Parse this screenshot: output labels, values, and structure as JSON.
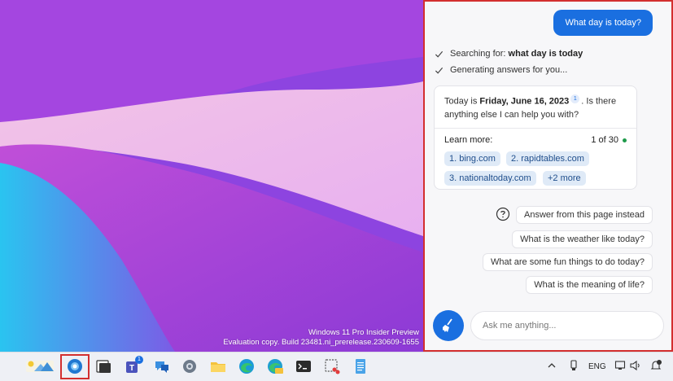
{
  "desktop": {
    "watermark_line1": "Windows 11 Pro Insider Preview",
    "watermark_line2": "Evaluation copy. Build 23481.ni_prerelease.230609-1655"
  },
  "copilot": {
    "user_message": "What day is today?",
    "status": [
      {
        "prefix": "Searching for: ",
        "bold": "what day is today"
      },
      {
        "prefix": "Generating answers for you...",
        "bold": ""
      }
    ],
    "answer": {
      "pre": "Today is ",
      "bold": "Friday, June 16, 2023",
      "citation": "1",
      "post": ". Is there anything else I can help you with?"
    },
    "learn_more": {
      "label": "Learn more:",
      "count": "1 of 30",
      "links": [
        "1. bing.com",
        "2. rapidtables.com",
        "3. nationaltoday.com",
        "+2 more"
      ]
    },
    "suggestions": [
      "Answer from this page instead",
      "What is the weather like today?",
      "What are some fun things to do today?",
      "What is the meaning of life?"
    ],
    "input_placeholder": "Ask me anything...",
    "colors": {
      "accent": "#1a6fe0",
      "highlight_border": "#d32f2f"
    }
  },
  "taskbar": {
    "icons": [
      "widgets-icon",
      "copilot-icon",
      "task-view-icon",
      "teams-icon",
      "chat-icon",
      "settings-icon",
      "file-explorer-icon",
      "edge-icon",
      "edge-canary-icon",
      "terminal-icon",
      "snipping-tool-icon",
      "notepad-icon"
    ],
    "teams_badge": "1",
    "tray": {
      "language": "ENG"
    }
  }
}
